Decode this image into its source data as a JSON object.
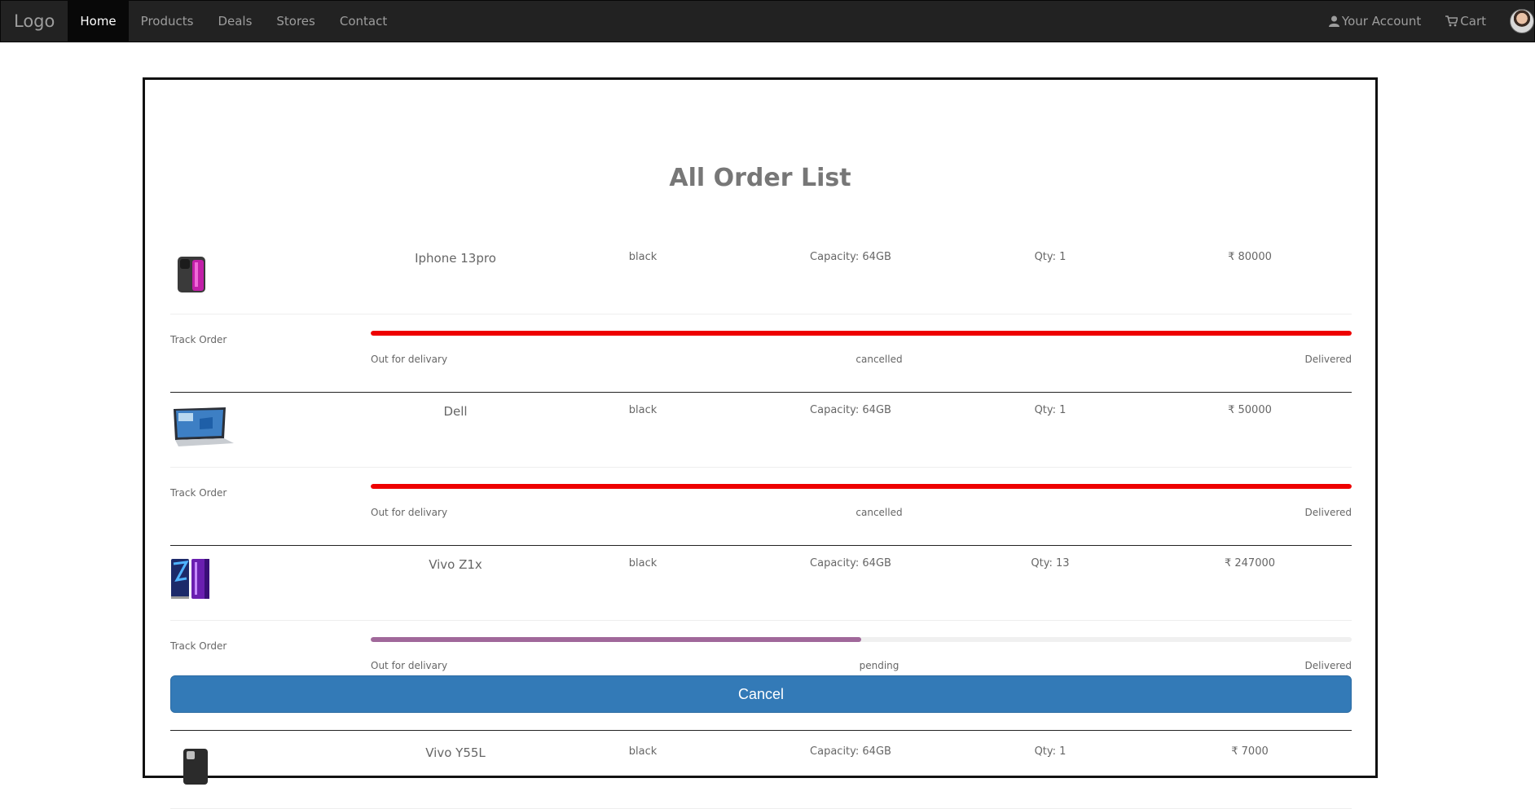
{
  "nav": {
    "brand": "Logo",
    "items": [
      {
        "label": "Home",
        "active": true
      },
      {
        "label": "Products"
      },
      {
        "label": "Deals"
      },
      {
        "label": "Stores"
      },
      {
        "label": "Contact"
      }
    ],
    "account_label": "Your Account",
    "cart_label": "Cart"
  },
  "page": {
    "title": "All Order List",
    "cancel_label": "Cancel"
  },
  "orders": [
    {
      "name": "Iphone 13pro",
      "color": "black",
      "capacity": "Capacity: 64GB",
      "qty": "Qty: 1",
      "price": "₹ 80000",
      "track_label": "Track Order",
      "step_start": "Out for delivary",
      "status": "cancelled",
      "step_end": "Delivered",
      "progress": 1.0,
      "bar_color": "#ee0000"
    },
    {
      "name": "Dell",
      "color": "black",
      "capacity": "Capacity: 64GB",
      "qty": "Qty: 1",
      "price": "₹ 50000",
      "track_label": "Track Order",
      "step_start": "Out for delivary",
      "status": "cancelled",
      "step_end": "Delivered",
      "progress": 1.0,
      "bar_color": "#ee0000"
    },
    {
      "name": "Vivo Z1x",
      "color": "black",
      "capacity": "Capacity: 64GB",
      "qty": "Qty: 13",
      "price": "₹ 247000",
      "track_label": "Track Order",
      "step_start": "Out for delivary",
      "status": "pending",
      "step_end": "Delivered",
      "progress": 0.5,
      "bar_color": "#a0689a"
    }
  ],
  "partial_order": {
    "name": "Vivo Y55L",
    "color": "black",
    "capacity": "Capacity: 64GB",
    "qty": "Qty: 1",
    "price": "₹ 7000"
  }
}
